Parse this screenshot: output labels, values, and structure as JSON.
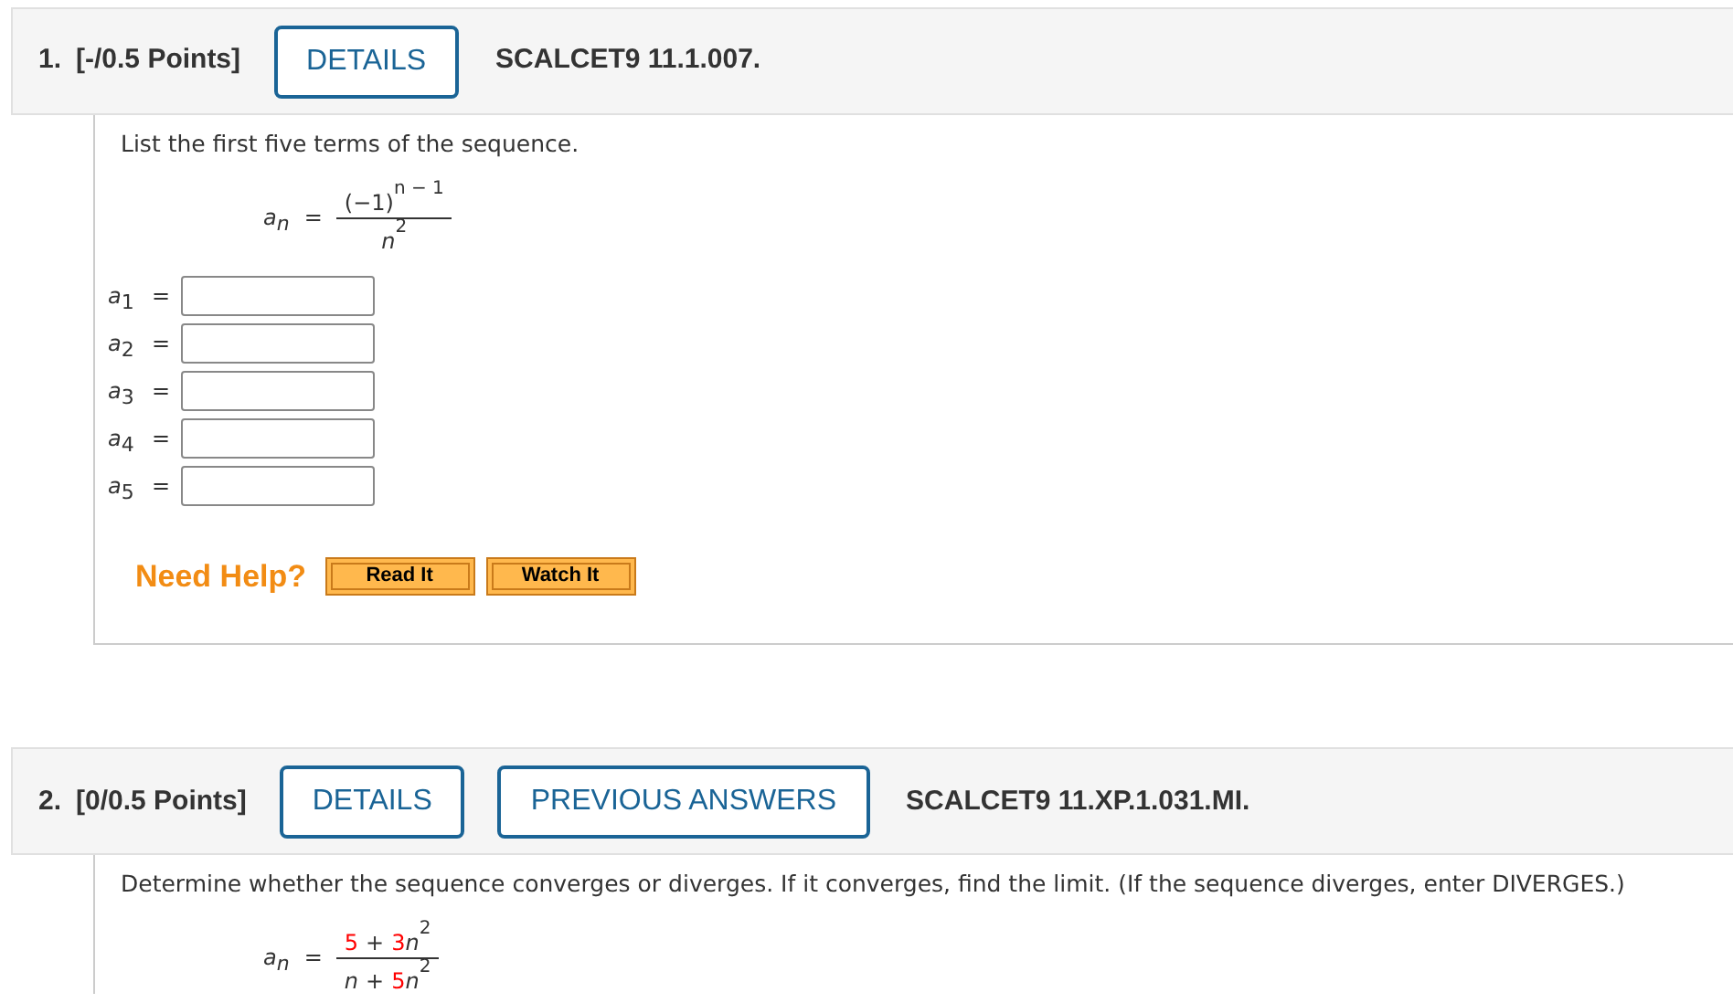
{
  "questions": [
    {
      "number": "1.",
      "points": "[-/0.5 Points]",
      "buttons": [
        "DETAILS"
      ],
      "code": "SCALCET9 11.1.007.",
      "prompt": "List the first five terms of the sequence.",
      "formula": {
        "lhs": "a",
        "lhs_sub": "n",
        "equals": "=",
        "numerator": [
          {
            "text": "(−1)",
            "kind": "number",
            "sup": "n − 1",
            "highlight": false
          }
        ],
        "denominator": [
          {
            "text": "n",
            "kind": "var",
            "sup": "2",
            "highlight": false
          }
        ]
      },
      "answers": [
        {
          "label": "a",
          "sub": "1",
          "equals": "="
        },
        {
          "label": "a",
          "sub": "2",
          "equals": "="
        },
        {
          "label": "a",
          "sub": "3",
          "equals": "="
        },
        {
          "label": "a",
          "sub": "4",
          "equals": "="
        },
        {
          "label": "a",
          "sub": "5",
          "equals": "="
        }
      ],
      "help": {
        "label": "Need Help?",
        "buttons": [
          "Read It",
          "Watch It"
        ]
      }
    },
    {
      "number": "2.",
      "points": "[0/0.5 Points]",
      "buttons": [
        "DETAILS",
        "PREVIOUS ANSWERS"
      ],
      "code": "SCALCET9 11.XP.1.031.MI.",
      "prompt": "Determine whether the sequence converges or diverges. If it converges, find the limit. (If the sequence diverges, enter DIVERGES.)",
      "formula": {
        "lhs": "a",
        "lhs_sub": "n",
        "equals": "=",
        "numerator": [
          {
            "text": "5",
            "kind": "number",
            "highlight": true
          },
          {
            "text": "+",
            "kind": "op",
            "highlight": false
          },
          {
            "text": "3",
            "kind": "number",
            "highlight": true
          },
          {
            "text": "n",
            "kind": "var",
            "sup": "2",
            "highlight": false
          }
        ],
        "denominator": [
          {
            "text": "n",
            "kind": "var",
            "highlight": false
          },
          {
            "text": "+",
            "kind": "op",
            "highlight": false
          },
          {
            "text": "5",
            "kind": "number",
            "highlight": true
          },
          {
            "text": "n",
            "kind": "var",
            "sup": "2",
            "highlight": false
          }
        ]
      }
    }
  ]
}
